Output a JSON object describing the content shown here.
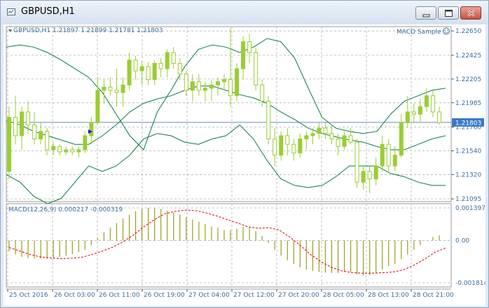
{
  "window": {
    "title": "GBPUSD,H1",
    "buttons": [
      "minimize",
      "maximize",
      "close"
    ]
  },
  "colors": {
    "background": "#ffffff",
    "grid": "#b0b0b0",
    "text": "#3b6d9a",
    "candle": "#9acd32",
    "bands": "#0b7a44",
    "macd_hist": "#9c9c1c",
    "macd_signal": "#e00000",
    "bid_line": "#336699",
    "price_label_bg": "#3a7ac6"
  },
  "main_chart": {
    "info_label": "GBPUSD,H1  1.21897 1.21899 1.21781 1.21803",
    "expert_label": "MACD Sample",
    "current_price": "1.21803",
    "price_labels": [
      "1.22650",
      "1.22425",
      "1.22205",
      "1.21985",
      "1.21760",
      "1.21540",
      "1.21320",
      "1.21095"
    ]
  },
  "indicator": {
    "label": "MACD(12,26,9) 0.000217 -0.000319",
    "scale_labels": [
      "0.001397",
      "0.00",
      "-0.001814"
    ]
  },
  "time_axis": {
    "labels": [
      "25 Oct 2016",
      "26 Oct 03:00",
      "26 Oct 11:00",
      "26 Oct 19:00",
      "27 Oct 04:00",
      "27 Oct 12:00",
      "27 Oct 20:00",
      "28 Oct 05:00",
      "28 Oct 13:00",
      "28 Oct 21:00"
    ]
  },
  "chart_data": {
    "type": "candlestick",
    "symbol": "GBPUSD",
    "timeframe": "H1",
    "price_range": [
      1.2107,
      1.2269
    ],
    "candles": [
      [
        1.2135,
        1.2195,
        1.2128,
        1.2185
      ],
      [
        1.2185,
        1.2205,
        1.216,
        1.2168
      ],
      [
        1.2168,
        1.2195,
        1.2155,
        1.219
      ],
      [
        1.219,
        1.22,
        1.217,
        1.2178
      ],
      [
        1.2178,
        1.219,
        1.216,
        1.2165
      ],
      [
        1.2165,
        1.218,
        1.216,
        1.2172
      ],
      [
        1.2172,
        1.2175,
        1.215,
        1.2155
      ],
      [
        1.2155,
        1.2162,
        1.215,
        1.2158
      ],
      [
        1.2158,
        1.216,
        1.215,
        1.2153
      ],
      [
        1.2153,
        1.2158,
        1.215,
        1.2155
      ],
      [
        1.2155,
        1.2158,
        1.215,
        1.2153
      ],
      [
        1.2153,
        1.2158,
        1.2148,
        1.2155
      ],
      [
        1.2155,
        1.2172,
        1.2152,
        1.2168
      ],
      [
        1.2168,
        1.2185,
        1.216,
        1.218
      ],
      [
        1.218,
        1.2222,
        1.2178,
        1.221
      ],
      [
        1.221,
        1.222,
        1.2198,
        1.2213
      ],
      [
        1.2213,
        1.2222,
        1.2205,
        1.221
      ],
      [
        1.221,
        1.223,
        1.2195,
        1.2208
      ],
      [
        1.2208,
        1.2222,
        1.2195,
        1.2215
      ],
      [
        1.2215,
        1.2245,
        1.221,
        1.2238
      ],
      [
        1.2238,
        1.2242,
        1.222,
        1.2228
      ],
      [
        1.2228,
        1.2237,
        1.2215,
        1.2232
      ],
      [
        1.2232,
        1.2236,
        1.2215,
        1.222
      ],
      [
        1.222,
        1.2238,
        1.2215,
        1.2235
      ],
      [
        1.2235,
        1.224,
        1.2222,
        1.223
      ],
      [
        1.223,
        1.2248,
        1.2222,
        1.2245
      ],
      [
        1.2245,
        1.225,
        1.223,
        1.2235
      ],
      [
        1.2235,
        1.224,
        1.222,
        1.2225
      ],
      [
        1.2225,
        1.2228,
        1.2205,
        1.221
      ],
      [
        1.221,
        1.2225,
        1.22,
        1.2218
      ],
      [
        1.2218,
        1.2225,
        1.2205,
        1.221
      ],
      [
        1.221,
        1.2218,
        1.22,
        1.2212
      ],
      [
        1.2212,
        1.222,
        1.22,
        1.2215
      ],
      [
        1.2215,
        1.2222,
        1.2205,
        1.2218
      ],
      [
        1.2218,
        1.2225,
        1.221,
        1.222
      ],
      [
        1.222,
        1.2268,
        1.2195,
        1.2205
      ],
      [
        1.2205,
        1.2235,
        1.22,
        1.223
      ],
      [
        1.223,
        1.226,
        1.222,
        1.2255
      ],
      [
        1.2255,
        1.2262,
        1.2235,
        1.2245
      ],
      [
        1.2245,
        1.225,
        1.221,
        1.2215
      ],
      [
        1.2215,
        1.222,
        1.2195,
        1.22
      ],
      [
        1.22,
        1.2205,
        1.216,
        1.2165
      ],
      [
        1.2165,
        1.2175,
        1.214,
        1.215
      ],
      [
        1.215,
        1.2172,
        1.2145,
        1.2168
      ],
      [
        1.2168,
        1.2175,
        1.215,
        1.216
      ],
      [
        1.216,
        1.2165,
        1.2145,
        1.2152
      ],
      [
        1.2152,
        1.217,
        1.2148,
        1.2165
      ],
      [
        1.2165,
        1.2172,
        1.2155,
        1.2168
      ],
      [
        1.2168,
        1.2175,
        1.216,
        1.217
      ],
      [
        1.217,
        1.218,
        1.2165,
        1.2175
      ],
      [
        1.2175,
        1.218,
        1.2165,
        1.217
      ],
      [
        1.217,
        1.2178,
        1.216,
        1.2165
      ],
      [
        1.2165,
        1.217,
        1.215,
        1.2158
      ],
      [
        1.2158,
        1.2172,
        1.2155,
        1.2168
      ],
      [
        1.2168,
        1.2175,
        1.216,
        1.2162
      ],
      [
        1.2162,
        1.2165,
        1.212,
        1.2125
      ],
      [
        1.2125,
        1.214,
        1.2118,
        1.2135
      ],
      [
        1.2135,
        1.214,
        1.2115,
        1.2128
      ],
      [
        1.2128,
        1.2148,
        1.2122,
        1.214
      ],
      [
        1.214,
        1.2168,
        1.2135,
        1.216
      ],
      [
        1.216,
        1.2165,
        1.2135,
        1.214
      ],
      [
        1.214,
        1.2158,
        1.2135,
        1.215
      ],
      [
        1.215,
        1.2188,
        1.2148,
        1.218
      ],
      [
        1.218,
        1.2205,
        1.2175,
        1.219
      ],
      [
        1.219,
        1.2198,
        1.218,
        1.2188
      ],
      [
        1.2188,
        1.2202,
        1.218,
        1.2195
      ],
      [
        1.2195,
        1.2212,
        1.219,
        1.2205
      ],
      [
        1.2205,
        1.221,
        1.2185,
        1.219
      ],
      [
        1.219,
        1.2195,
        1.2178,
        1.218
      ]
    ],
    "bollinger_upper": [
      1.225,
      1.2252,
      1.225,
      1.2245,
      1.2238,
      1.223,
      1.2222,
      1.2208,
      1.2188,
      1.2168,
      1.2155,
      1.219,
      1.221,
      1.2232,
      1.2248,
      1.2252,
      1.225,
      1.2245,
      1.225,
      1.2258,
      1.2255,
      1.224,
      1.2212,
      1.2185,
      1.2175,
      1.2172,
      1.217,
      1.2172,
      1.2188,
      1.22,
      1.2205,
      1.221,
      1.2212
    ],
    "bollinger_middle": [
      1.2182,
      1.2178,
      1.2172,
      1.2168,
      1.2164,
      1.216,
      1.216,
      1.2168,
      1.2178,
      1.219,
      1.2198,
      1.2202,
      1.2205,
      1.221,
      1.2214,
      1.2214,
      1.221,
      1.2206,
      1.2203,
      1.2198,
      1.219,
      1.2183,
      1.2175,
      1.217,
      1.2167,
      1.2164,
      1.2162,
      1.2158,
      1.2155,
      1.2155,
      1.216,
      1.2165,
      1.2168
    ],
    "bollinger_lower": [
      1.2132,
      1.2125,
      1.2112,
      1.2105,
      1.211,
      1.2125,
      1.214,
      1.2135,
      1.214,
      1.215,
      1.2165,
      1.217,
      1.2168,
      1.2162,
      1.216,
      1.2165,
      1.2168,
      1.2178,
      1.2165,
      1.2145,
      1.2128,
      1.2122,
      1.212,
      1.2122,
      1.213,
      1.214,
      1.214,
      1.214,
      1.2133,
      1.213,
      1.2125,
      1.2122,
      1.2122
    ],
    "macd_histogram": [
      -0.00045,
      -0.0006,
      -0.0007,
      -0.00075,
      -0.00078,
      -0.00078,
      -0.00078,
      -0.00075,
      -0.0007,
      -0.00065,
      -0.00058,
      -0.0005,
      -0.0004,
      -0.0002,
      0.0001,
      0.00035,
      0.00055,
      0.00075,
      0.00095,
      0.0011,
      0.00125,
      0.00135,
      0.0014,
      0.00139,
      0.00135,
      0.00128,
      0.0012,
      0.00112,
      0.001,
      0.0009,
      0.0008,
      0.0007,
      0.0006,
      0.00055,
      0.00045,
      0.00045,
      0.0005,
      0.00058,
      0.00055,
      0.0004,
      0.0002,
      -0.0001,
      -0.0004,
      -0.00065,
      -0.00085,
      -0.001,
      -0.00115,
      -0.00125,
      -0.0013,
      -0.00135,
      -0.00138,
      -0.0014,
      -0.0014,
      -0.00135,
      -0.00135,
      -0.00145,
      -0.0015,
      -0.00148,
      -0.0014,
      -0.00125,
      -0.0011,
      -0.001,
      -0.0008,
      -0.0006,
      -0.0004,
      -0.0002,
      0.0,
      0.00015,
      0.00022
    ],
    "macd_signal": [
      -0.0003,
      -0.00045,
      -0.0006,
      -0.0007,
      -0.00075,
      -0.00078,
      -0.00076,
      -0.00072,
      -0.0006,
      -0.00045,
      -0.00028,
      -5e-05,
      0.00025,
      0.0006,
      0.0009,
      0.00115,
      0.00125,
      0.0013,
      0.00128,
      0.00118,
      0.00105,
      0.0009,
      0.00075,
      0.00058,
      0.00052,
      0.00055,
      0.00045,
      0.00015,
      -0.0002,
      -0.0006,
      -0.0009,
      -0.00115,
      -0.0013,
      -0.00138,
      -0.0014,
      -0.0014,
      -0.00138,
      -0.00135,
      -0.00125,
      -0.00105,
      -0.0008,
      -0.0005,
      -0.00032
    ]
  }
}
